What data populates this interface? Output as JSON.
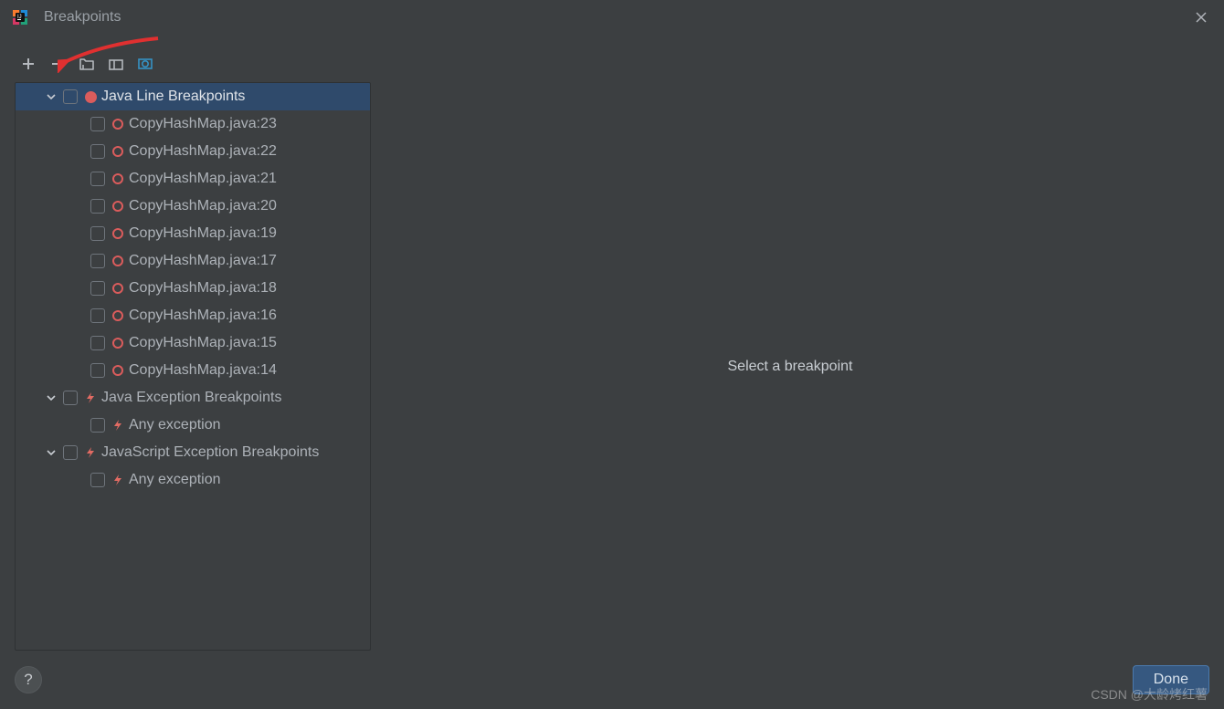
{
  "window": {
    "title": "Breakpoints"
  },
  "detail": {
    "placeholder": "Select a breakpoint"
  },
  "buttons": {
    "done": "Done",
    "help": "?"
  },
  "watermark": "CSDN @大龄烤红薯",
  "tree": {
    "groups": [
      {
        "label": "Java Line Breakpoints",
        "icon": "circle-filled",
        "selected": true,
        "items": [
          {
            "label": "CopyHashMap.java:23"
          },
          {
            "label": "CopyHashMap.java:22"
          },
          {
            "label": "CopyHashMap.java:21"
          },
          {
            "label": "CopyHashMap.java:20"
          },
          {
            "label": "CopyHashMap.java:19"
          },
          {
            "label": "CopyHashMap.java:17"
          },
          {
            "label": "CopyHashMap.java:18"
          },
          {
            "label": "CopyHashMap.java:16"
          },
          {
            "label": "CopyHashMap.java:15"
          },
          {
            "label": "CopyHashMap.java:14"
          }
        ]
      },
      {
        "label": "Java Exception Breakpoints",
        "icon": "bolt",
        "items": [
          {
            "label": "Any exception"
          }
        ]
      },
      {
        "label": "JavaScript Exception Breakpoints",
        "icon": "bolt",
        "items": [
          {
            "label": "Any exception"
          }
        ]
      }
    ]
  }
}
